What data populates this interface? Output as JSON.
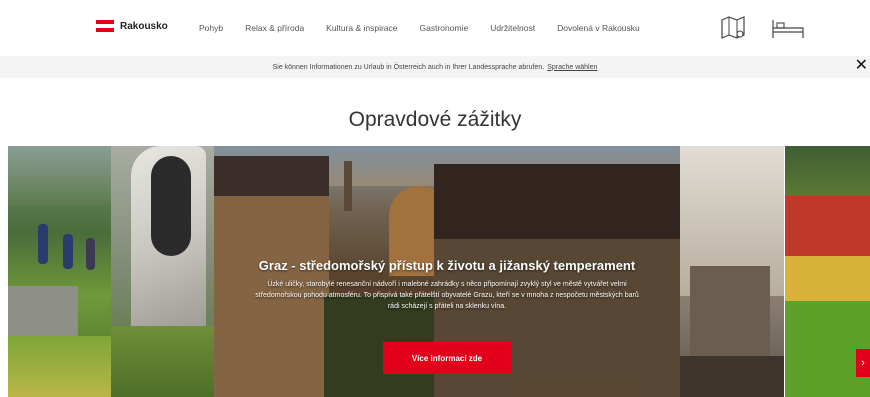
{
  "header": {
    "logo_text": "Rakousko",
    "nav": [
      "Pohyb",
      "Relax & příroda",
      "Kultura & inspirace",
      "Gastronomie",
      "Udržitelnost",
      "Dovolená v Rakousku"
    ],
    "icons": [
      "map-icon",
      "bed-icon"
    ]
  },
  "infobar": {
    "text": "Sie können Informationen zu Urlaub in Österreich auch in Ihrer Landessprache abrufen.",
    "link": "Sprache wählen"
  },
  "section": {
    "title": "Opravdové zážitky"
  },
  "slide": {
    "title": "Graz - středomořský přístup k životu a jižanský temperament",
    "description": "Úzké uličky, starobylé renesanční nádvoří i malebné zahrádky s něco připomínají zvyklý styl ve městě vytvářet velmi středomořskou pohodu atmosféru. To přispívá také přátelští obyvatelé Grazu, kteří se v mnoha z nespočetu městských barů rádi scházejí s přáteli na sklenku vína.",
    "cta": "Více informací zde"
  },
  "colors": {
    "accent": "#e2001a"
  }
}
